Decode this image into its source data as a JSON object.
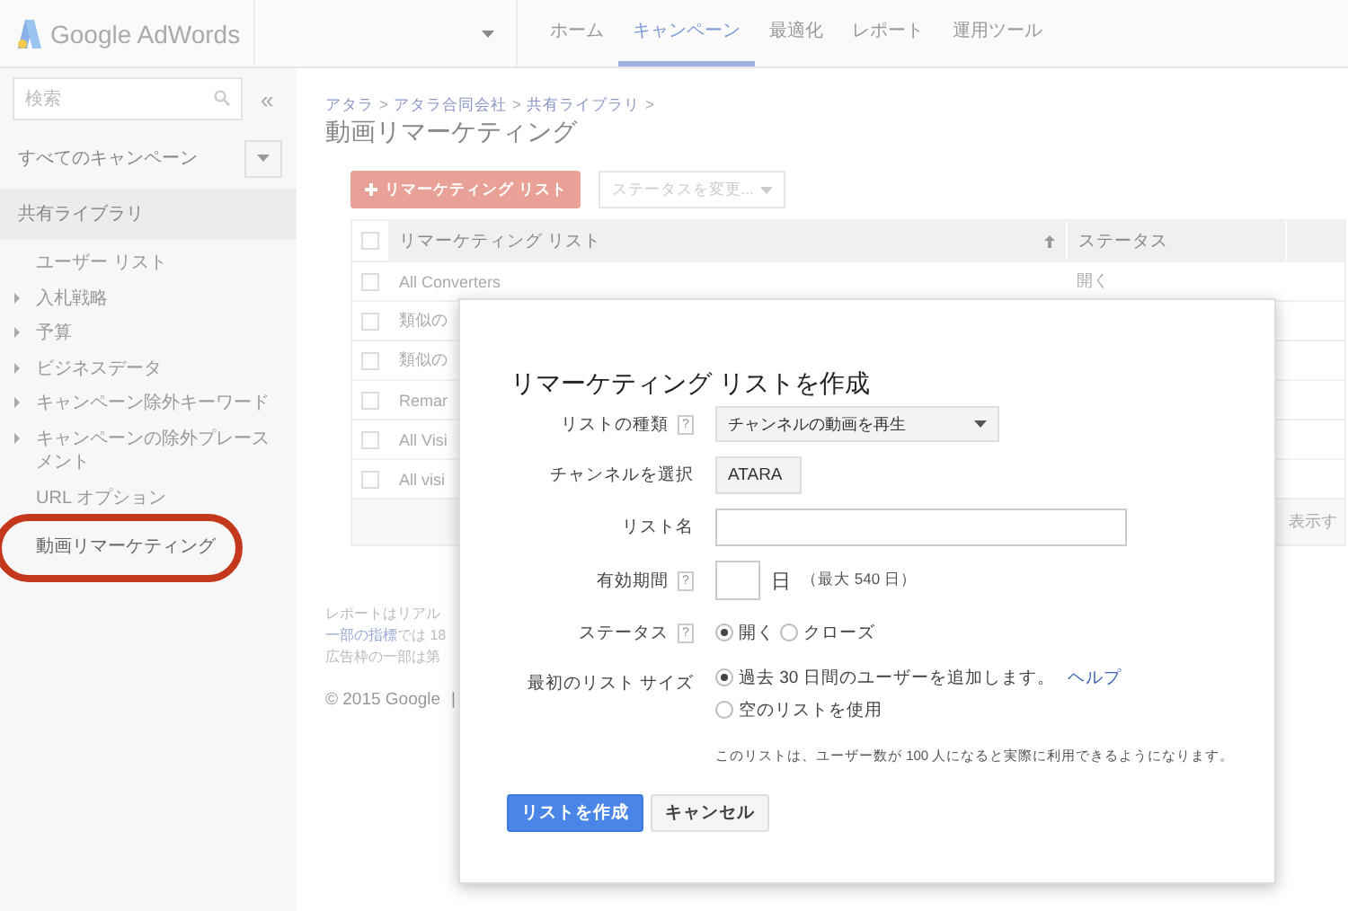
{
  "header": {
    "logo": "Google AdWords",
    "tabs": [
      {
        "label": "ホーム",
        "selected": false
      },
      {
        "label": "キャンペーン",
        "selected": true
      },
      {
        "label": "最適化",
        "selected": false
      },
      {
        "label": "レポート",
        "selected": false
      },
      {
        "label": "運用ツール",
        "selected": false
      }
    ]
  },
  "sidebar": {
    "search": {
      "placeholder": "検索"
    },
    "collapse": "«",
    "campaigns": "すべてのキャンペーン",
    "section": "共有ライブラリ",
    "items": [
      {
        "label": "ユーザー リスト",
        "expandable": false,
        "circled": false
      },
      {
        "label": "入札戦略",
        "expandable": true,
        "circled": false
      },
      {
        "label": "予算",
        "expandable": true,
        "circled": false
      },
      {
        "label": "ビジネスデータ",
        "expandable": true,
        "circled": false
      },
      {
        "label": "キャンペーン除外キーワード",
        "expandable": true,
        "circled": false
      },
      {
        "label": "キャンペーンの除外プレースメント",
        "expandable": true,
        "circled": false
      },
      {
        "label": "URL オプション",
        "expandable": false,
        "circled": false
      },
      {
        "label": "動画リマーケティング",
        "expandable": false,
        "circled": true
      }
    ]
  },
  "main": {
    "breadcrumb": [
      {
        "label": "アタラ"
      },
      {
        "label": "アタラ合同会社"
      },
      {
        "label": "共有ライブラリ"
      }
    ],
    "separator": ">",
    "title": "動画リマーケティング",
    "add_button": "リマーケティング リスト",
    "status_dropdown": {
      "label": "ステータスを変更...",
      "disabled": true
    },
    "table": {
      "select_all_checked": false,
      "columns": [
        "リマーケティング リスト",
        "ステータス"
      ],
      "rows": [
        {
          "name": "All Converters",
          "status": "開く",
          "checked": false
        },
        {
          "name": "類似の",
          "checked": false
        },
        {
          "name": "類似の",
          "checked": false
        },
        {
          "name": "Remar",
          "checked": false
        },
        {
          "name": "All Visi",
          "checked": false
        },
        {
          "name": "All visi",
          "checked": false
        }
      ],
      "footer": "表示す"
    },
    "notes": [
      [
        {
          "text": "レポートはリアル"
        }
      ],
      [
        {
          "text": "一部の指標",
          "link": true
        },
        {
          "text": "では 18"
        }
      ],
      [
        {
          "text": "広告枠の一部は第"
        }
      ]
    ],
    "copyright": "© 2015 Google",
    "copyright_separator": "|"
  },
  "dialog": {
    "title": "リマーケティング リストを作成",
    "fields": [
      {
        "kind": "select",
        "label": "リストの種類",
        "help": "?",
        "value": "チャンネルの動画を再生",
        "wide": true
      },
      {
        "kind": "select",
        "label": "チャンネルを選択",
        "value": "ATARA",
        "wide": false
      },
      {
        "kind": "text",
        "label": "リスト名"
      },
      {
        "kind": "days",
        "label": "有効期間",
        "help": "?",
        "unit": "日",
        "hint": "（最大 540 日）"
      },
      {
        "kind": "radio-inline",
        "label": "ステータス",
        "help": "?",
        "options": [
          {
            "label": "開く",
            "selected": true
          },
          {
            "label": "クローズ",
            "selected": false
          }
        ]
      },
      {
        "kind": "radio-stack",
        "label": "最初のリスト サイズ",
        "options": [
          {
            "label": "過去 30 日間のユーザーを追加します。",
            "link": "ヘルプ",
            "selected": true
          },
          {
            "label": "空のリストを使用",
            "selected": false
          }
        ]
      }
    ],
    "note": "このリストは、ユーザー数が 100 人になると実際に利用できるようになります。",
    "buttons": [
      {
        "label": "リストを作成",
        "kind": "primary"
      },
      {
        "label": "キャンセル",
        "kind": "secondary"
      }
    ]
  }
}
